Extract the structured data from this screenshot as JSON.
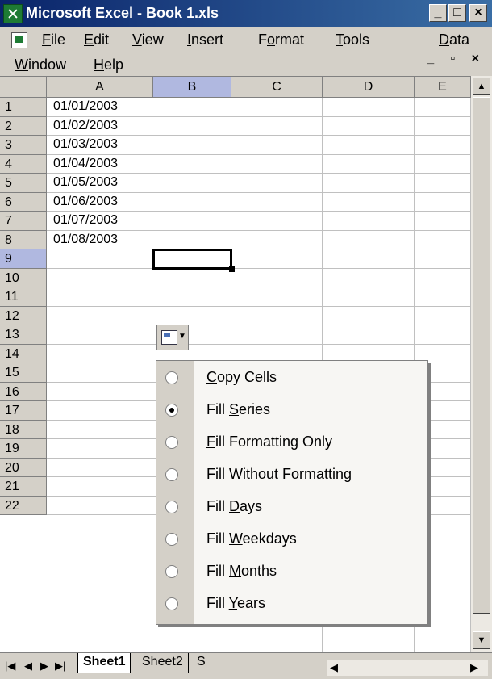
{
  "window": {
    "title": "Microsoft Excel - Book 1.xls",
    "buttons": [
      "minimize",
      "restore",
      "close"
    ]
  },
  "menu": {
    "row1": [
      "File",
      "Edit",
      "View",
      "Insert",
      "Format",
      "Tools",
      "Data"
    ],
    "row2": [
      "Window",
      "Help"
    ]
  },
  "grid": {
    "columns": [
      "A",
      "B",
      "C",
      "D",
      "E"
    ],
    "rows": [
      "1",
      "2",
      "3",
      "4",
      "5",
      "6",
      "7",
      "8",
      "9",
      "10",
      "11",
      "12",
      "13",
      "14",
      "15",
      "16",
      "17",
      "18",
      "19",
      "20",
      "21",
      "22"
    ],
    "col_a_values": [
      "01/01/2003",
      "01/02/2003",
      "01/03/2003",
      "01/04/2003",
      "01/05/2003",
      "01/06/2003",
      "01/07/2003",
      "01/08/2003"
    ],
    "selected_column": "B",
    "selected_row": "9"
  },
  "autofill_menu": {
    "items": [
      {
        "label": "Copy Cells",
        "selected": false
      },
      {
        "label": "Fill Series",
        "selected": true
      },
      {
        "label": "Fill Formatting Only",
        "selected": false
      },
      {
        "label": "Fill Without Formatting",
        "selected": false
      },
      {
        "label": "Fill Days",
        "selected": false
      },
      {
        "label": "Fill Weekdays",
        "selected": false
      },
      {
        "label": "Fill Months",
        "selected": false
      },
      {
        "label": "Fill Years",
        "selected": false
      }
    ]
  },
  "sheets": {
    "tabs": [
      "Sheet1",
      "Sheet2",
      "S"
    ],
    "active": "Sheet1"
  },
  "colors": {
    "titlebar_start": "#0a246a",
    "titlebar_end": "#3a6ea5",
    "selected_header": "#b0b8e0",
    "chrome": "#d4d0c8"
  }
}
